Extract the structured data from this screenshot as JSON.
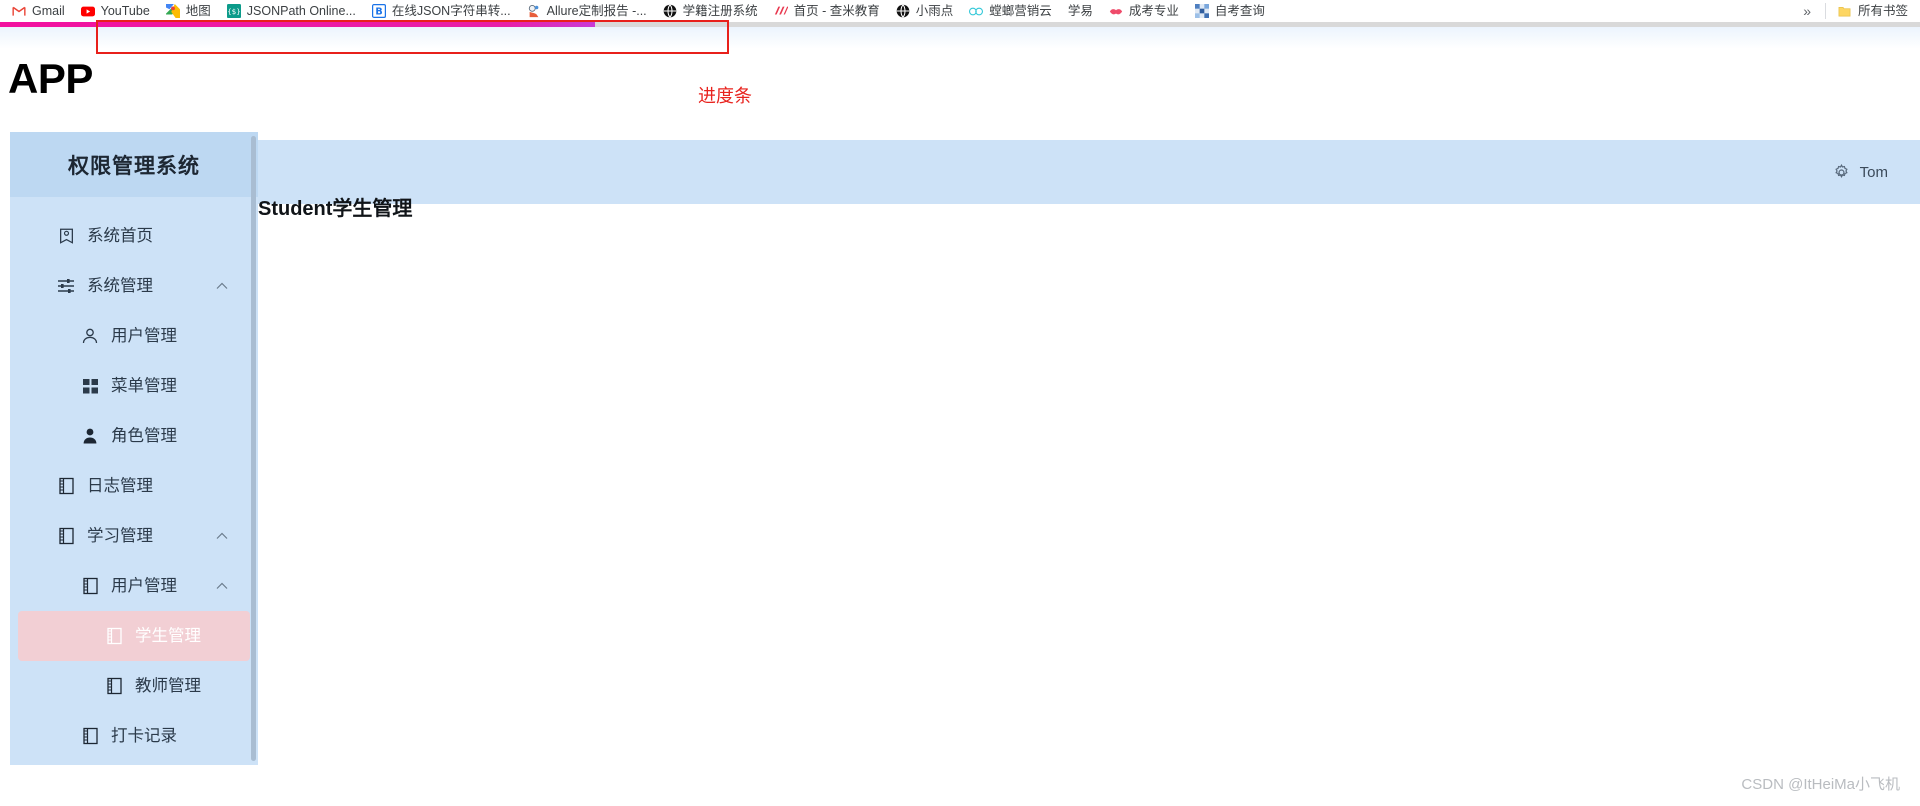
{
  "browser": {
    "bookmarks": [
      {
        "label": "Gmail",
        "icon": "gmail-icon"
      },
      {
        "label": "YouTube",
        "icon": "youtube-icon"
      },
      {
        "label": "地图",
        "icon": "google-maps-icon"
      },
      {
        "label": "JSONPath Online...",
        "icon": "jsonpath-icon"
      },
      {
        "label": "在线JSON字符串转...",
        "icon": "bejson-icon"
      },
      {
        "label": "Allure定制报告 -...",
        "icon": "allure-icon"
      },
      {
        "label": "学籍注册系统",
        "icon": "globe-icon"
      },
      {
        "label": "首页 - 查米教育",
        "icon": "chami-icon"
      },
      {
        "label": "小雨点",
        "icon": "globe-icon"
      },
      {
        "label": "螳螂营销云",
        "icon": "mantis-icon"
      },
      {
        "label": "学易",
        "icon": "none-icon"
      },
      {
        "label": "成考专业",
        "icon": "lips-icon"
      },
      {
        "label": "自考查询",
        "icon": "mosaic-icon"
      }
    ],
    "overflow_label": "»",
    "all_bookmarks_label": "所有书签",
    "all_bookmarks_icon": "folder-icon"
  },
  "annotation": {
    "label": "进度条",
    "color": "#e8231e"
  },
  "progress": {
    "percent": 31,
    "fill_color": "#ec1ab7",
    "track_color": "#d9d9d9"
  },
  "page": {
    "app_title": "APP"
  },
  "sidebar": {
    "title": "权限管理系统",
    "bg_color": "#cde2f7",
    "active_color": "#f2cfd4",
    "items": [
      {
        "label": "系统首页",
        "icon": "home-shield-icon",
        "level": 1,
        "arrow": "",
        "active": false
      },
      {
        "label": "系统管理",
        "icon": "sliders-icon",
        "level": 1,
        "arrow": "⌃",
        "active": false
      },
      {
        "label": "用户管理",
        "icon": "user-outline-icon",
        "level": 2,
        "arrow": "",
        "active": false
      },
      {
        "label": "菜单管理",
        "icon": "grid-icon",
        "level": 2,
        "arrow": "",
        "active": false
      },
      {
        "label": "角色管理",
        "icon": "user-solid-icon",
        "level": 2,
        "arrow": "",
        "active": false
      },
      {
        "label": "日志管理",
        "icon": "notebook-icon",
        "level": 1,
        "arrow": "",
        "active": false
      },
      {
        "label": "学习管理",
        "icon": "notebook-icon",
        "level": 1,
        "arrow": "⌃",
        "active": false
      },
      {
        "label": "用户管理",
        "icon": "notebook-icon",
        "level": 2,
        "arrow": "⌃",
        "active": false
      },
      {
        "label": "学生管理",
        "icon": "notebook-icon",
        "level": 3,
        "arrow": "",
        "active": true
      },
      {
        "label": "教师管理",
        "icon": "notebook-icon",
        "level": 3,
        "arrow": "",
        "active": false
      },
      {
        "label": "打卡记录",
        "icon": "notebook-icon",
        "level": 2,
        "arrow": "",
        "active": false
      }
    ]
  },
  "topbar": {
    "user_name": "Tom",
    "gear_icon": "gear-icon"
  },
  "content": {
    "title": "Student学生管理"
  },
  "watermark": {
    "text": "CSDN @ItHeiMa小飞机"
  }
}
